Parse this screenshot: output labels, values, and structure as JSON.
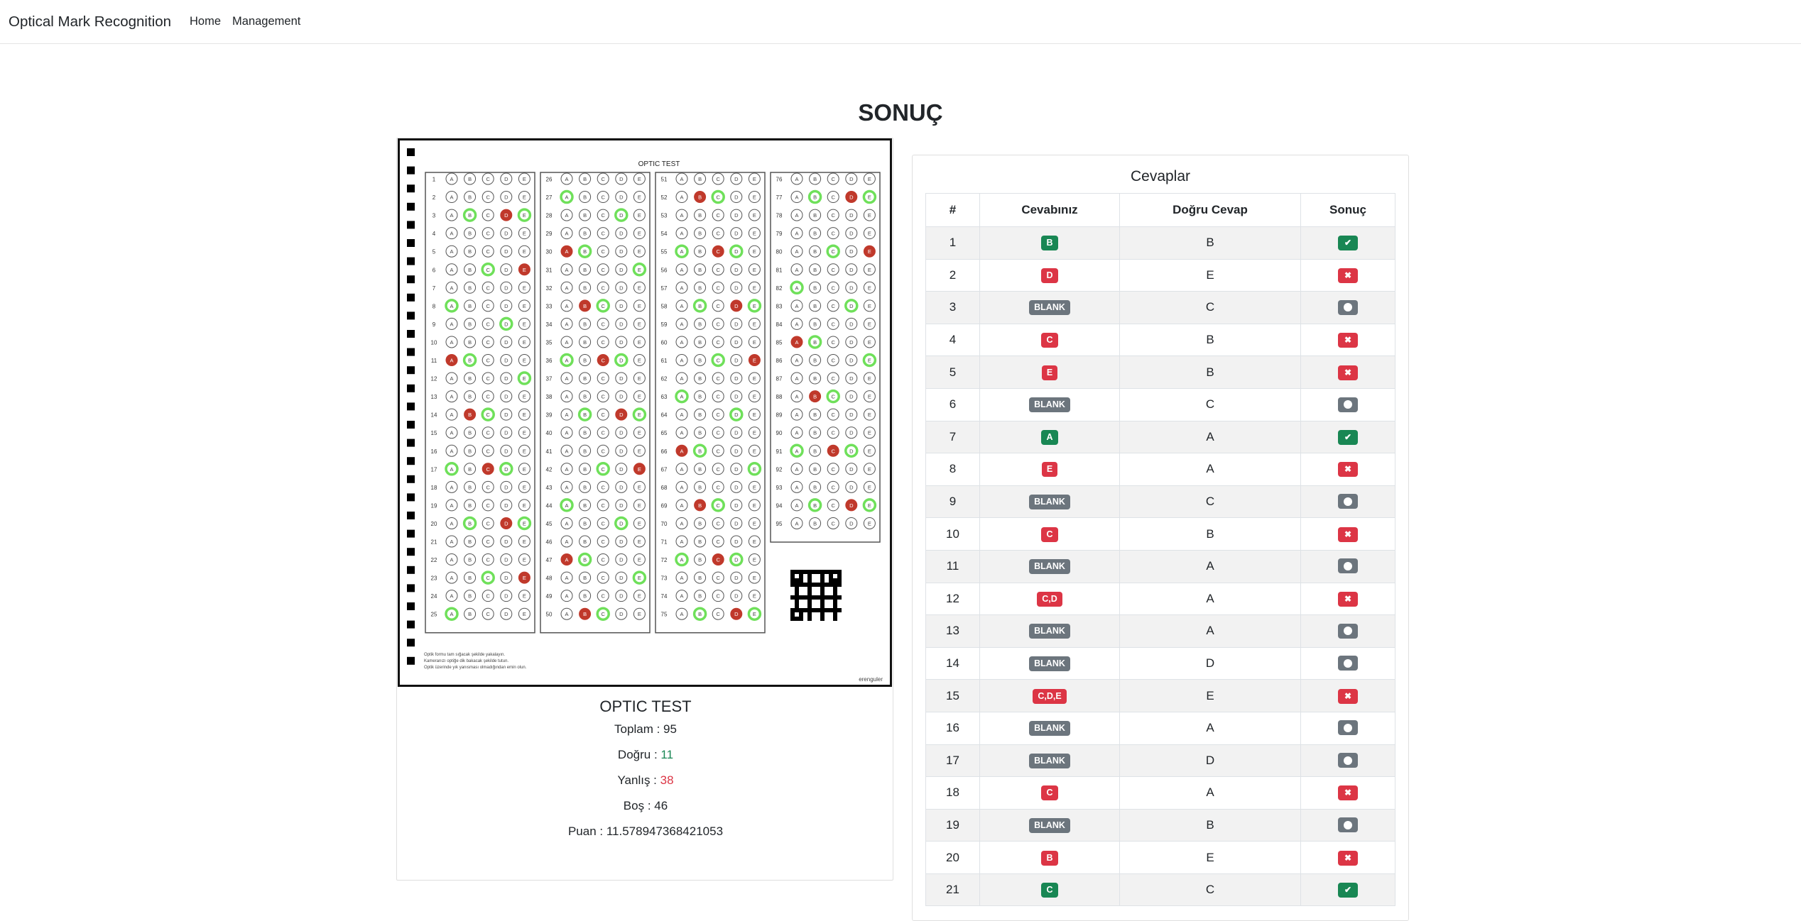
{
  "nav": {
    "brand": "Optical Mark Recognition",
    "links": [
      "Home",
      "Management"
    ]
  },
  "page_title": "SONUÇ",
  "sheet": {
    "title": "OPTIC TEST",
    "footer_lines": [
      "Optik formu tam sığacak şekilde yakalayın.",
      "Kameranızı optiğe dik bakacak şekilde tutun.",
      "Optik üzerinde yık yanısması olmadığından emin olun."
    ],
    "footer_brand": "erenguler",
    "options": [
      "A",
      "B",
      "C",
      "D",
      "E"
    ]
  },
  "summary": {
    "title": "OPTIC TEST",
    "total_label": "Toplam : ",
    "total": "95",
    "correct_label": "Doğru : ",
    "correct": "11",
    "wrong_label": "Yanlış : ",
    "wrong": "38",
    "blank_label": "Boş : ",
    "blank": "46",
    "score_label": "Puan : ",
    "score": "11.578947368421053"
  },
  "answers_card": {
    "title": "Cevaplar",
    "headers": [
      "#",
      "Cevabınız",
      "Doğru Cevap",
      "Sonuç"
    ],
    "rows": [
      {
        "n": "1",
        "given": "B",
        "correct": "B",
        "result": "correct"
      },
      {
        "n": "2",
        "given": "D",
        "correct": "E",
        "result": "wrong"
      },
      {
        "n": "3",
        "given": "BLANK",
        "correct": "C",
        "result": "blank"
      },
      {
        "n": "4",
        "given": "C",
        "correct": "B",
        "result": "wrong"
      },
      {
        "n": "5",
        "given": "E",
        "correct": "B",
        "result": "wrong"
      },
      {
        "n": "6",
        "given": "BLANK",
        "correct": "C",
        "result": "blank"
      },
      {
        "n": "7",
        "given": "A",
        "correct": "A",
        "result": "correct"
      },
      {
        "n": "8",
        "given": "E",
        "correct": "A",
        "result": "wrong"
      },
      {
        "n": "9",
        "given": "BLANK",
        "correct": "C",
        "result": "blank"
      },
      {
        "n": "10",
        "given": "C",
        "correct": "B",
        "result": "wrong"
      },
      {
        "n": "11",
        "given": "BLANK",
        "correct": "A",
        "result": "blank"
      },
      {
        "n": "12",
        "given": "C,D",
        "correct": "A",
        "result": "wrong"
      },
      {
        "n": "13",
        "given": "BLANK",
        "correct": "A",
        "result": "blank"
      },
      {
        "n": "14",
        "given": "BLANK",
        "correct": "D",
        "result": "blank"
      },
      {
        "n": "15",
        "given": "C,D,E",
        "correct": "E",
        "result": "wrong"
      },
      {
        "n": "16",
        "given": "BLANK",
        "correct": "A",
        "result": "blank"
      },
      {
        "n": "17",
        "given": "BLANK",
        "correct": "D",
        "result": "blank"
      },
      {
        "n": "18",
        "given": "C",
        "correct": "A",
        "result": "wrong"
      },
      {
        "n": "19",
        "given": "BLANK",
        "correct": "B",
        "result": "blank"
      },
      {
        "n": "20",
        "given": "B",
        "correct": "E",
        "result": "wrong"
      },
      {
        "n": "21",
        "given": "C",
        "correct": "C",
        "result": "correct"
      }
    ]
  },
  "colors": {
    "correct": "#198754",
    "wrong": "#dc3545",
    "blank": "#6c757d",
    "mark_green": "#6fe05a",
    "mark_red": "#c0392b"
  }
}
